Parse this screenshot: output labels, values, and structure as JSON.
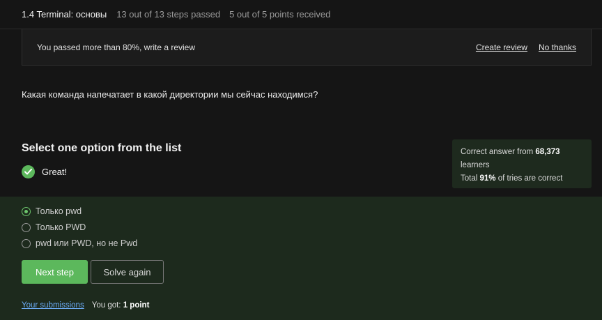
{
  "header": {
    "title": "1.4 Terminal: основы",
    "steps": "13 out of 13 steps passed",
    "points": "5 out of 5 points  received"
  },
  "banner": {
    "message": "You passed more than 80%, write a review",
    "create_review": "Create review",
    "no_thanks": "No thanks"
  },
  "question": "Какая команда напечатает в какой директории мы сейчас находимся?",
  "select_heading": "Select one option from the list",
  "feedback": {
    "icon": "check-circle-icon",
    "text": "Great!"
  },
  "stats": {
    "line1_prefix": "Correct answer from ",
    "learners_count": "68,373",
    "line1_suffix": "learners",
    "line2_prefix": "Total ",
    "percent": "91%",
    "line2_suffix": " of tries are correct"
  },
  "options": [
    {
      "label": "Только pwd",
      "selected": true
    },
    {
      "label": "Только PWD",
      "selected": false
    },
    {
      "label": "pwd или PWD, но не Pwd",
      "selected": false
    }
  ],
  "buttons": {
    "next": "Next step",
    "solve_again": "Solve again"
  },
  "footer": {
    "submissions": "Your submissions",
    "got_prefix": "You got: ",
    "got_value": "1 point"
  },
  "colors": {
    "accent": "#5cb85c",
    "answer_bg": "#1d2a1d",
    "link": "#6aa9f0"
  }
}
